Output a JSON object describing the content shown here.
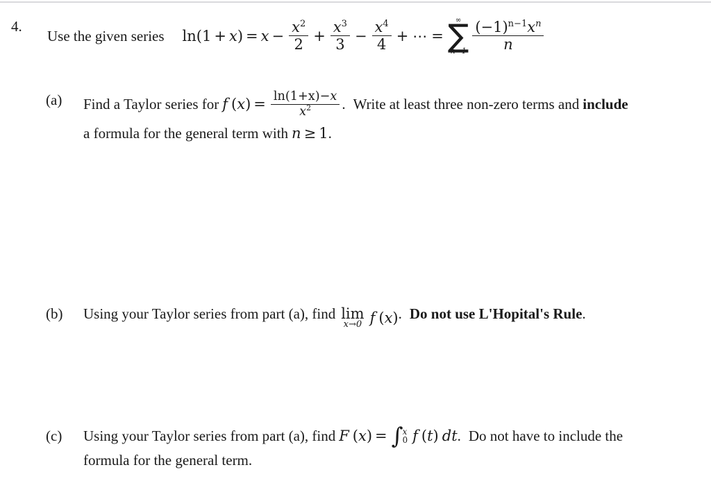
{
  "document": {
    "type": "math-worksheet-problem",
    "background_color": "#ffffff",
    "text_color": "#1a1a1a",
    "rule_color": "#d9d9dc"
  },
  "problem": {
    "number": "4.",
    "prompt": "Use the given series",
    "given_series": {
      "lhs_func": "ln",
      "lhs_arg_open": "(",
      "lhs_one": "1",
      "lhs_plus": "+",
      "lhs_var": "x",
      "lhs_arg_close": ")",
      "equals": "=",
      "term1": "x",
      "minus1": "−",
      "term2_num_var": "x",
      "term2_num_exp": "2",
      "term2_den": "2",
      "plus1": "+",
      "term3_num_var": "x",
      "term3_num_exp": "3",
      "term3_den": "3",
      "minus2": "−",
      "term4_num_var": "x",
      "term4_num_exp": "4",
      "term4_den": "4",
      "plus2": "+",
      "ellipsis": "⋯",
      "equals2": "=",
      "sum_upper": "∞",
      "sum_glyph": "∑",
      "sum_lower": "n=1",
      "sum_num_base": "(−1)",
      "sum_num_exp": "n−1",
      "sum_num_var": "x",
      "sum_num_var_exp": "n",
      "sum_den": "n"
    }
  },
  "parts": [
    {
      "label": "(a)",
      "line1_pre": "Find a Taylor series for",
      "f_name": "f",
      "f_open": "(",
      "f_var": "x",
      "f_close": ")",
      "f_equals": "=",
      "frac_num_func": "ln(1+x)",
      "frac_num_minus": "−",
      "frac_num_var": "x",
      "frac_den_var": "x",
      "frac_den_exp": "2",
      "period": ".",
      "line1_post_plain": "Write at least three non-zero terms and",
      "line1_post_bold": "include",
      "line2_pre": "a formula for the general term with",
      "line2_var": "n",
      "line2_rel": "≥",
      "line2_val": "1",
      "line2_period": "."
    },
    {
      "label": "(b)",
      "line1_pre": "Using your Taylor series from part (a), find",
      "lim_label": "lim",
      "lim_sub": "x→0",
      "f_name": "f",
      "f_open": "(",
      "f_var": "x",
      "f_close": ")",
      "period": ".",
      "bold_text": "Do not use L'Hopital's Rule",
      "end_period": "."
    },
    {
      "label": "(c)",
      "line1_pre": "Using your Taylor series from part (a), find",
      "F_name": "F",
      "F_open": "(",
      "F_var": "x",
      "F_close": ")",
      "F_equals": "=",
      "integral_glyph": "∫",
      "integral_upper": "x",
      "integral_lower": "0",
      "integrand_f": "f",
      "integrand_open": "(",
      "integrand_var": "t",
      "integrand_close": ")",
      "differential": "dt",
      "period": ".",
      "line1_post": "Do not have to include the",
      "line2": "formula for the general term."
    }
  ]
}
